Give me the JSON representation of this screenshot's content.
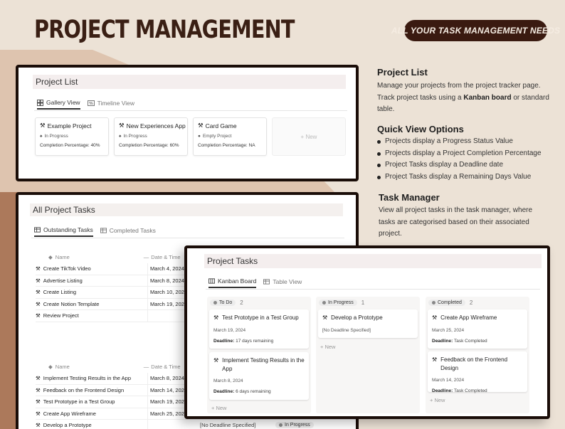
{
  "header": {
    "title": "PROJECT MANAGEMENT",
    "tagline": "ALL YOUR TASK MANAGEMENT NEEDS"
  },
  "colors": {
    "brand_dark": "#3a1a10",
    "accent_bg": "#eadfd2",
    "frame_border": "#1a0d08"
  },
  "project_list": {
    "title": "Project List",
    "tabs": [
      {
        "label": "Gallery View",
        "icon": "gallery-icon"
      },
      {
        "label": "Timeline View",
        "icon": "timeline-icon"
      }
    ],
    "cards": [
      {
        "title": "Example Project",
        "status": "In Progress",
        "pct_label": "Completion Percentage:",
        "pct": "40%"
      },
      {
        "title": "New Experiences App",
        "status": "In Progress",
        "pct_label": "Completion Percentage:",
        "pct": "60%"
      },
      {
        "title": "Card Game",
        "status": "Empty Project",
        "pct_label": "Completion Percentage:",
        "pct": "NA"
      }
    ],
    "new_label": "+ New"
  },
  "all_tasks": {
    "title": "All Project Tasks",
    "tabs": [
      {
        "label": "Outstanding Tasks",
        "icon": "table-icon"
      },
      {
        "label": "Completed Tasks",
        "icon": "table-icon"
      }
    ],
    "col_name": "Name",
    "col_date": "Date & Time",
    "group1": [
      {
        "name": "Create TikTok Video",
        "date": "March 4, 2024"
      },
      {
        "name": "Advertise Listing",
        "date": "March 8, 2024"
      },
      {
        "name": "Create Listing",
        "date": "March 10, 2024"
      },
      {
        "name": "Create Notion Template",
        "date": "March 19, 2024"
      },
      {
        "name": "Review Project",
        "date": ""
      }
    ],
    "group2": [
      {
        "name": "Implement Testing Results in the App",
        "date": "March 8, 2024",
        "deadline": "",
        "status": ""
      },
      {
        "name": "Feedback on the Frontend Design",
        "date": "March 14, 2024",
        "deadline": "",
        "status": ""
      },
      {
        "name": "Test Prototype in a Test Group",
        "date": "March 19, 2024",
        "deadline": "",
        "status": ""
      },
      {
        "name": "Create App Wireframe",
        "date": "March 25, 2024",
        "deadline": "",
        "status": ""
      },
      {
        "name": "Develop a Prototype",
        "date": "",
        "deadline": "[No Deadline Specified]",
        "status": "In Progress"
      }
    ]
  },
  "info": {
    "project_list_heading": "Project List",
    "project_list_text_1": "Manage your projects from the project tracker page. Track project tasks using a ",
    "project_list_bold": "Kanban board",
    "project_list_text_2": " or standard table.",
    "quick_heading": "Quick View Options",
    "quick_items": [
      "Projects display a Progress Status Value",
      "Projects display a Project Completion Percentage",
      "Project Tasks display a Deadline date",
      "Project Tasks display a Remaining Days Value"
    ],
    "task_heading": "Task Manager",
    "task_text": "View all project tasks in the task manager, where tasks are categorised based on their associated project."
  },
  "kanban": {
    "title": "Project Tasks",
    "tabs": [
      {
        "label": "Kanban Board",
        "icon": "kanban-icon"
      },
      {
        "label": "Table View",
        "icon": "table-icon"
      }
    ],
    "deadline_label": "Deadline:",
    "new_label": "+ New",
    "columns": [
      {
        "label": "To Do",
        "count": "2",
        "cards": [
          {
            "title": "Test Prototype in a Test Group",
            "date": "March 19, 2024",
            "deadline": "17 days remaining"
          },
          {
            "title": "Implement Testing Results in the App",
            "date": "March 8, 2024",
            "deadline": "6 days remaining"
          }
        ]
      },
      {
        "label": "In Progress",
        "count": "1",
        "cards": [
          {
            "title": "Develop a Prototype",
            "date": "[No Deadline Specified]",
            "deadline": ""
          }
        ]
      },
      {
        "label": "Completed",
        "count": "2",
        "cards": [
          {
            "title": "Create App Wireframe",
            "date": "March 25, 2024",
            "deadline": "Task Completed"
          },
          {
            "title": "Feedback on the Frontend Design",
            "date": "March 14, 2024",
            "deadline": "Task Completed"
          }
        ]
      }
    ]
  }
}
